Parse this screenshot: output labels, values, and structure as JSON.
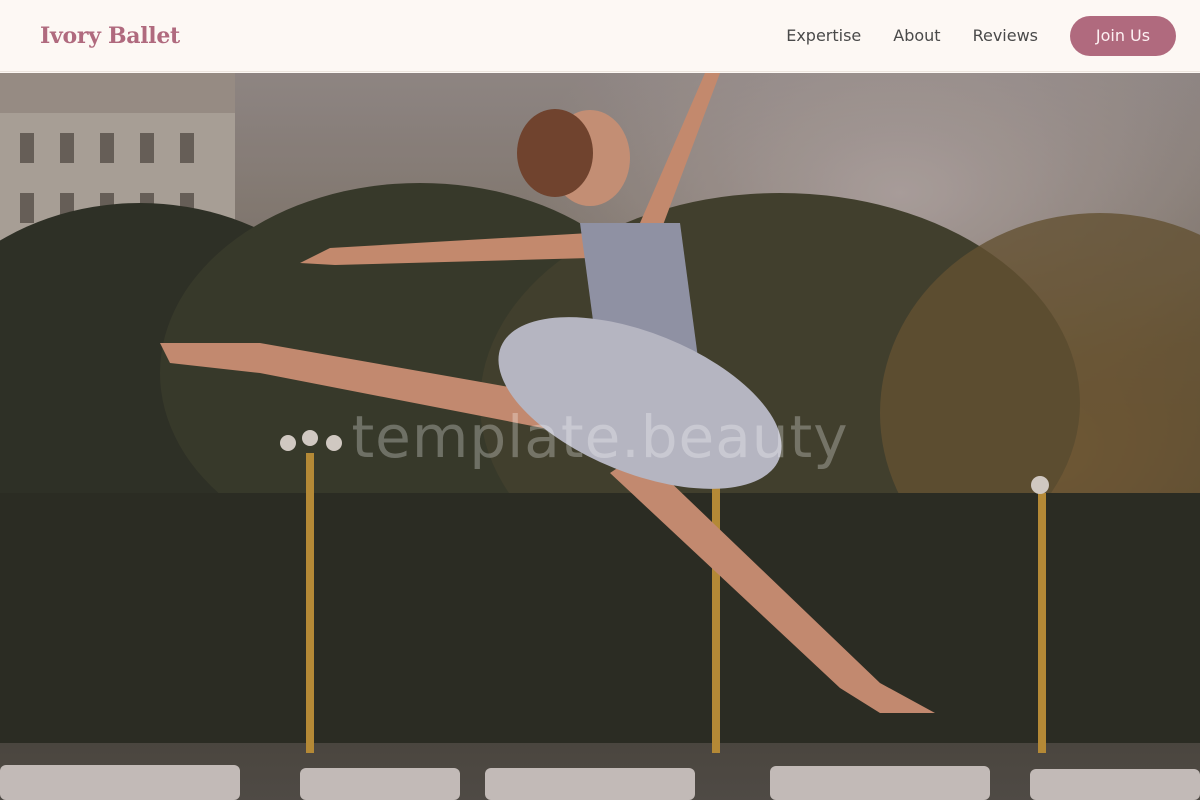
{
  "brand": {
    "name": "Ivory Ballet"
  },
  "nav": {
    "links": [
      {
        "label": "Expertise"
      },
      {
        "label": "About"
      },
      {
        "label": "Reviews"
      }
    ],
    "cta_label": "Join Us"
  },
  "hero": {
    "watermark": "template.beauty",
    "image_subject": "ballerina leaping in a park at sunset"
  },
  "colors": {
    "accent": "#b06a7e",
    "background": "#fdf8f4",
    "nav_text": "#4a4a4a"
  }
}
